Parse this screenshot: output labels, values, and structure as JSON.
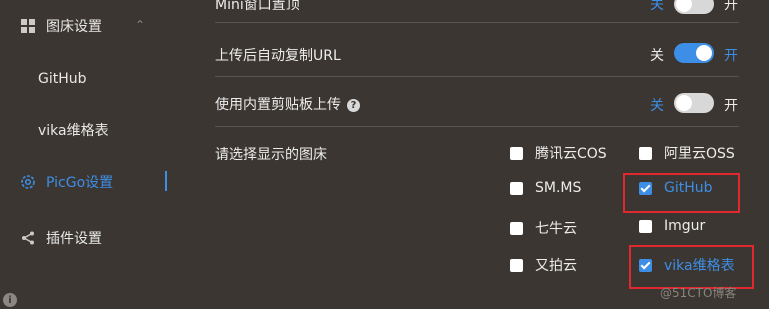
{
  "sidebar": {
    "items": [
      {
        "label": "图床设置",
        "icon": "grid-icon",
        "chevron": "⌃"
      },
      {
        "label": "GitHub"
      },
      {
        "label": "vika维格表"
      },
      {
        "label": "PicGo设置",
        "icon": "gear-icon",
        "active": true
      },
      {
        "label": "插件设置",
        "icon": "share-icon"
      }
    ],
    "info_icon": "i"
  },
  "settings": {
    "mini_window": {
      "label": "Mini窗口置顶",
      "off": "关",
      "on": "开",
      "state": false
    },
    "auto_copy": {
      "label": "上传后自动复制URL",
      "off": "关",
      "on": "开",
      "state": true
    },
    "clipboard": {
      "label": "使用内置剪贴板上传",
      "help": "?",
      "off": "关",
      "on": "开",
      "state": false
    },
    "choose_label": "请选择显示的图床"
  },
  "picbeds": [
    {
      "label": "腾讯云COS",
      "checked": false
    },
    {
      "label": "阿里云OSS",
      "checked": false
    },
    {
      "label": "SM.MS",
      "checked": false
    },
    {
      "label": "GitHub",
      "checked": true
    },
    {
      "label": "七牛云",
      "checked": false
    },
    {
      "label": "Imgur",
      "checked": false
    },
    {
      "label": "又拍云",
      "checked": false
    },
    {
      "label": "vika维格表",
      "checked": true
    }
  ],
  "watermark": "@51CTO博客",
  "colors": {
    "accent": "#3d8ee6",
    "background": "#3b3631",
    "highlight": "#e0282e"
  }
}
